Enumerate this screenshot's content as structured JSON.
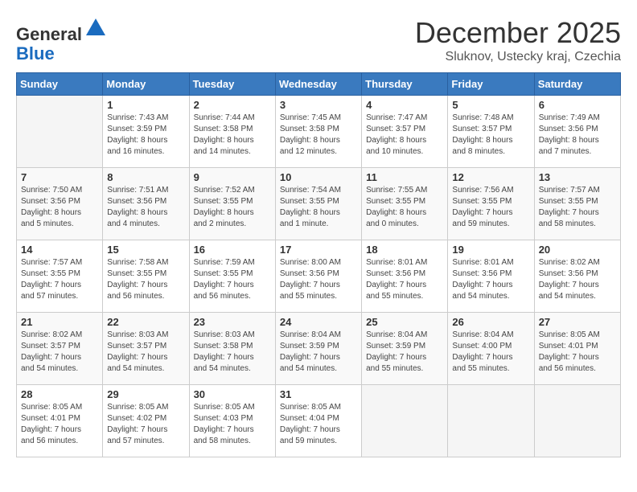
{
  "header": {
    "logo_general": "General",
    "logo_blue": "Blue",
    "month_title": "December 2025",
    "location": "Sluknov, Ustecky kraj, Czechia"
  },
  "days_of_week": [
    "Sunday",
    "Monday",
    "Tuesday",
    "Wednesday",
    "Thursday",
    "Friday",
    "Saturday"
  ],
  "weeks": [
    [
      {
        "num": "",
        "info": ""
      },
      {
        "num": "1",
        "info": "Sunrise: 7:43 AM\nSunset: 3:59 PM\nDaylight: 8 hours\nand 16 minutes."
      },
      {
        "num": "2",
        "info": "Sunrise: 7:44 AM\nSunset: 3:58 PM\nDaylight: 8 hours\nand 14 minutes."
      },
      {
        "num": "3",
        "info": "Sunrise: 7:45 AM\nSunset: 3:58 PM\nDaylight: 8 hours\nand 12 minutes."
      },
      {
        "num": "4",
        "info": "Sunrise: 7:47 AM\nSunset: 3:57 PM\nDaylight: 8 hours\nand 10 minutes."
      },
      {
        "num": "5",
        "info": "Sunrise: 7:48 AM\nSunset: 3:57 PM\nDaylight: 8 hours\nand 8 minutes."
      },
      {
        "num": "6",
        "info": "Sunrise: 7:49 AM\nSunset: 3:56 PM\nDaylight: 8 hours\nand 7 minutes."
      }
    ],
    [
      {
        "num": "7",
        "info": "Sunrise: 7:50 AM\nSunset: 3:56 PM\nDaylight: 8 hours\nand 5 minutes."
      },
      {
        "num": "8",
        "info": "Sunrise: 7:51 AM\nSunset: 3:56 PM\nDaylight: 8 hours\nand 4 minutes."
      },
      {
        "num": "9",
        "info": "Sunrise: 7:52 AM\nSunset: 3:55 PM\nDaylight: 8 hours\nand 2 minutes."
      },
      {
        "num": "10",
        "info": "Sunrise: 7:54 AM\nSunset: 3:55 PM\nDaylight: 8 hours\nand 1 minute."
      },
      {
        "num": "11",
        "info": "Sunrise: 7:55 AM\nSunset: 3:55 PM\nDaylight: 8 hours\nand 0 minutes."
      },
      {
        "num": "12",
        "info": "Sunrise: 7:56 AM\nSunset: 3:55 PM\nDaylight: 7 hours\nand 59 minutes."
      },
      {
        "num": "13",
        "info": "Sunrise: 7:57 AM\nSunset: 3:55 PM\nDaylight: 7 hours\nand 58 minutes."
      }
    ],
    [
      {
        "num": "14",
        "info": "Sunrise: 7:57 AM\nSunset: 3:55 PM\nDaylight: 7 hours\nand 57 minutes."
      },
      {
        "num": "15",
        "info": "Sunrise: 7:58 AM\nSunset: 3:55 PM\nDaylight: 7 hours\nand 56 minutes."
      },
      {
        "num": "16",
        "info": "Sunrise: 7:59 AM\nSunset: 3:55 PM\nDaylight: 7 hours\nand 56 minutes."
      },
      {
        "num": "17",
        "info": "Sunrise: 8:00 AM\nSunset: 3:56 PM\nDaylight: 7 hours\nand 55 minutes."
      },
      {
        "num": "18",
        "info": "Sunrise: 8:01 AM\nSunset: 3:56 PM\nDaylight: 7 hours\nand 55 minutes."
      },
      {
        "num": "19",
        "info": "Sunrise: 8:01 AM\nSunset: 3:56 PM\nDaylight: 7 hours\nand 54 minutes."
      },
      {
        "num": "20",
        "info": "Sunrise: 8:02 AM\nSunset: 3:56 PM\nDaylight: 7 hours\nand 54 minutes."
      }
    ],
    [
      {
        "num": "21",
        "info": "Sunrise: 8:02 AM\nSunset: 3:57 PM\nDaylight: 7 hours\nand 54 minutes."
      },
      {
        "num": "22",
        "info": "Sunrise: 8:03 AM\nSunset: 3:57 PM\nDaylight: 7 hours\nand 54 minutes."
      },
      {
        "num": "23",
        "info": "Sunrise: 8:03 AM\nSunset: 3:58 PM\nDaylight: 7 hours\nand 54 minutes."
      },
      {
        "num": "24",
        "info": "Sunrise: 8:04 AM\nSunset: 3:59 PM\nDaylight: 7 hours\nand 54 minutes."
      },
      {
        "num": "25",
        "info": "Sunrise: 8:04 AM\nSunset: 3:59 PM\nDaylight: 7 hours\nand 55 minutes."
      },
      {
        "num": "26",
        "info": "Sunrise: 8:04 AM\nSunset: 4:00 PM\nDaylight: 7 hours\nand 55 minutes."
      },
      {
        "num": "27",
        "info": "Sunrise: 8:05 AM\nSunset: 4:01 PM\nDaylight: 7 hours\nand 56 minutes."
      }
    ],
    [
      {
        "num": "28",
        "info": "Sunrise: 8:05 AM\nSunset: 4:01 PM\nDaylight: 7 hours\nand 56 minutes."
      },
      {
        "num": "29",
        "info": "Sunrise: 8:05 AM\nSunset: 4:02 PM\nDaylight: 7 hours\nand 57 minutes."
      },
      {
        "num": "30",
        "info": "Sunrise: 8:05 AM\nSunset: 4:03 PM\nDaylight: 7 hours\nand 58 minutes."
      },
      {
        "num": "31",
        "info": "Sunrise: 8:05 AM\nSunset: 4:04 PM\nDaylight: 7 hours\nand 59 minutes."
      },
      {
        "num": "",
        "info": ""
      },
      {
        "num": "",
        "info": ""
      },
      {
        "num": "",
        "info": ""
      }
    ]
  ]
}
